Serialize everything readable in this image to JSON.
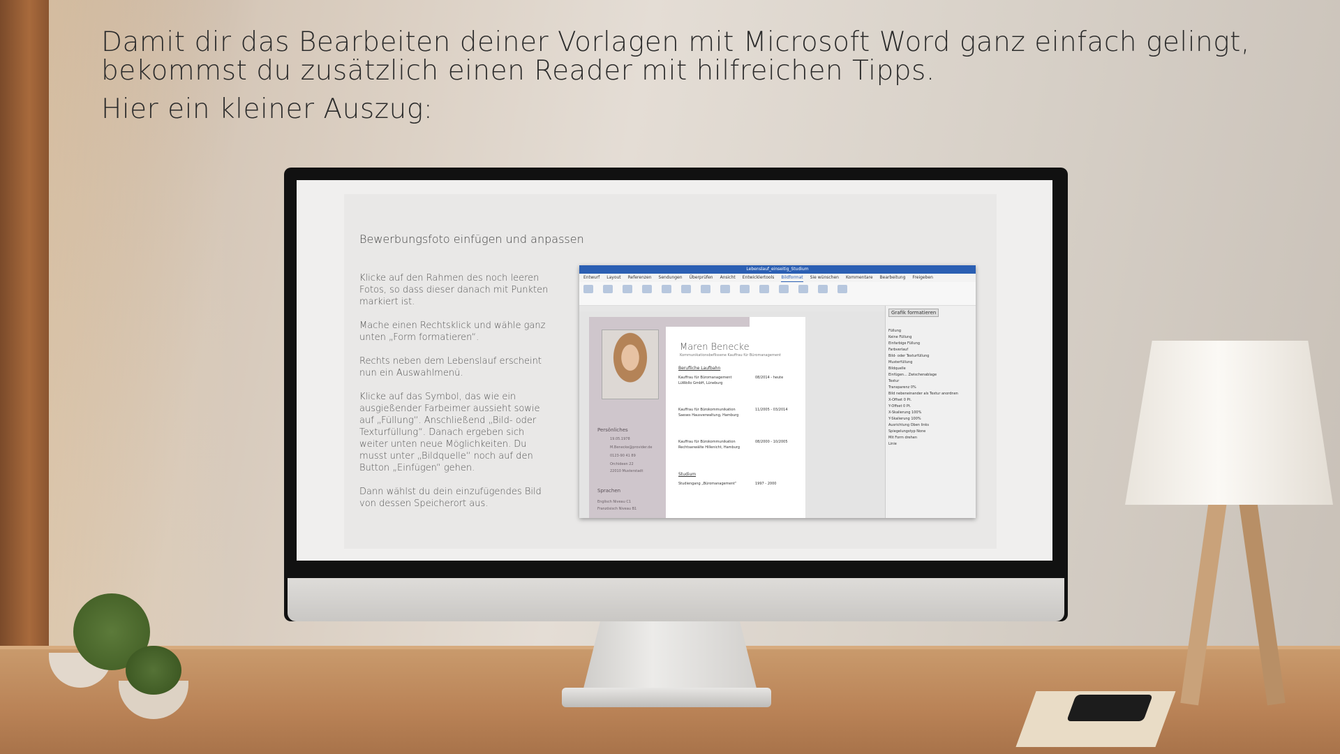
{
  "headline": {
    "line1": "Damit dir das Bearbeiten deiner Vorlagen mit Microsoft Word ganz einfach gelingt,",
    "line2": "bekommst du zusätzlich einen Reader mit hilfreichen Tipps.",
    "line3": "Hier ein kleiner Auszug:"
  },
  "slide": {
    "title": "Bewerbungsfoto einfügen und anpassen",
    "steps": [
      "Klicke auf den Rahmen des noch leeren Fotos, so dass dieser danach mit Punkten markiert ist.",
      "Mache einen Rechtsklick und wähle ganz unten „Form formatieren“.",
      "Rechts neben dem Lebenslauf erscheint nun ein Auswahlmenü.",
      "Klicke auf das Symbol, das wie ein ausgießender Farbeimer aussieht sowie auf „Füllung“. Anschließend „Bild- oder Texturfüllung“. Danach ergeben sich weiter unten neue Möglichkeiten. Du musst unter „Bildquelle“ noch auf den Button „Einfügen“ gehen.",
      "Dann wählst du dein einzufügendes Bild von dessen Speicherort aus."
    ]
  },
  "word": {
    "doc_title": "Lebenslauf_einseitig_Studium",
    "tabs": [
      "Entwurf",
      "Layout",
      "Referenzen",
      "Sendungen",
      "Überprüfen",
      "Ansicht",
      "Entwicklertools",
      "Bildformat",
      "Sie wünschen"
    ],
    "active_tab": "Bildformat",
    "right_actions": [
      "Kommentare",
      "Bearbeitung",
      "Freigeben"
    ],
    "resume": {
      "name": "Maren Benecke",
      "subtitle": "Kommunikationsbeflissene Kauffrau für Büromanagement",
      "section_career": "Berufliche Laufbahn",
      "job1": "Kauffrau für Büromanagement",
      "job1_company": "LüWollo GmbH, Lüneburg",
      "job1_date": "08/2014 - heute",
      "job2": "Kauffrau für Bürokommunikation",
      "job2_company": "Saeses Hausverwaltung, Hamburg",
      "job2_date": "11/2005 - 03/2014",
      "job3": "Kauffrau für Bürokommunikation",
      "job3_company": "Rechtsanwälte Hillenicht, Hamburg",
      "job3_date": "08/2000 - 10/2005",
      "section_study": "Studium",
      "study1": "Studiengang „Büromanagement“",
      "study1_date": "1997 - 2000",
      "section_personal": "Persönliches",
      "personal": [
        "19.05.1978",
        "M.Benecke@provider.de",
        "0123-90 41 89",
        "Orchideen 22",
        "22010 Musterstadt"
      ],
      "section_languages": "Sprachen",
      "languages": [
        "Englisch   Niveau C1",
        "Französisch  Niveau B1"
      ]
    },
    "pane": {
      "title": "Grafik formatieren",
      "section_fill": "Füllung",
      "options": [
        "Keine Füllung",
        "Einfarbige Füllung",
        "Farbverlauf",
        "Bild- oder Texturfüllung",
        "Musterfüllung"
      ],
      "image_source": "Bildquelle",
      "insert_button": "Einfügen...",
      "clipboard_button": "Zwischenablage",
      "texture": "Textur",
      "transparency": "Transparenz",
      "transparency_value": "0%",
      "tile": "Bild nebeneinander als Textur anordnen",
      "x_offset": "X-Offset",
      "x_value": "0 Pt.",
      "y_offset": "Y-Offset",
      "y_value": "0 Pt.",
      "x_scale": "X-Skalierung",
      "x_scale_value": "100%",
      "y_scale": "Y-Skalierung",
      "y_scale_value": "100%",
      "alignment": "Ausrichtung",
      "alignment_value": "Oben links",
      "mirror": "Spiegelungstyp",
      "mirror_value": "None",
      "rotate": "Mit Form drehen",
      "line": "Linie"
    }
  }
}
